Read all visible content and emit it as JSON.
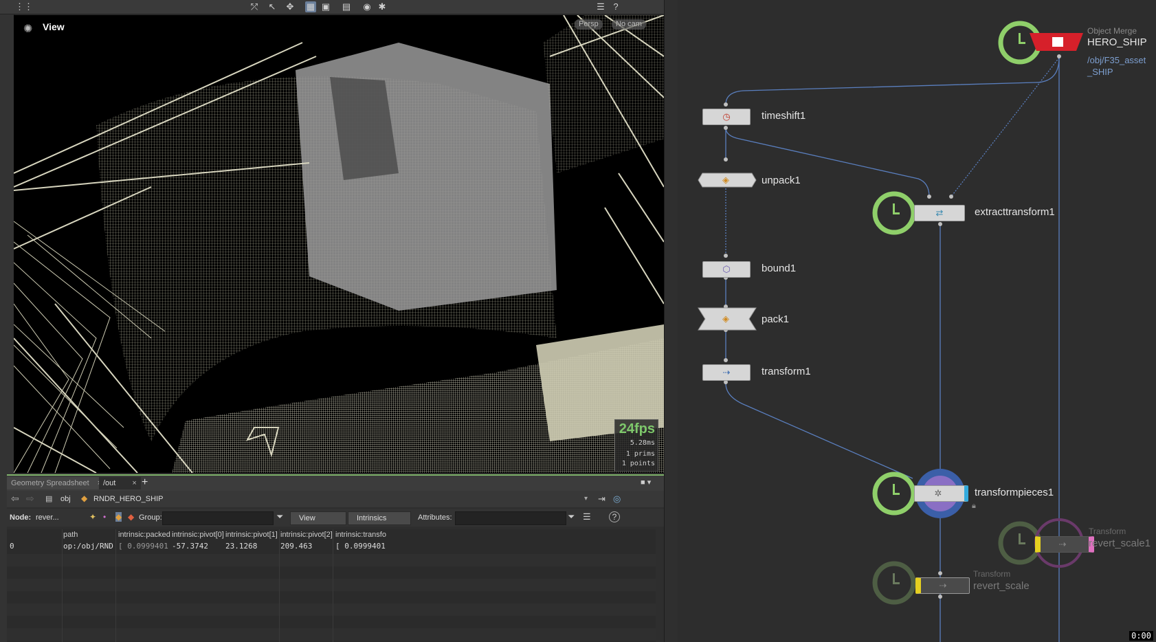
{
  "viewport": {
    "title": "View",
    "camera_mode": "Persp",
    "camera_name": "No cam",
    "fps": "24fps",
    "render_time": "5.28ms",
    "prims": "1  prims",
    "points": "1 points"
  },
  "spreadsheet": {
    "tabs": [
      {
        "label": "Geometry Spreadsheet"
      },
      {
        "label": "/out"
      }
    ],
    "path": {
      "root": "obj",
      "node": "RNDR_HERO_SHIP"
    },
    "filter": {
      "node_label": "Node:",
      "node_value": "rever...",
      "group_label": "Group:",
      "view_value": "View",
      "intrinsics_value": "Intrinsics",
      "attributes_label": "Attributes:"
    },
    "columns": [
      "path",
      "intrinsic:packed",
      "intrinsic:pivot[0]",
      "intrinsic:pivot[1]",
      "intrinsic:pivot[2]",
      "intrinsic:transfo"
    ],
    "rows": [
      {
        "index": "0",
        "cells": [
          "op:/obj/RND",
          "[ 0.0999401",
          "-57.3742",
          "23.1268",
          "209.463",
          "[ 0.0999401"
        ]
      }
    ]
  },
  "network": {
    "object_merge": {
      "type": "Object Merge",
      "name": "HERO_SHIP",
      "path_line1": "/obj/F35_asset",
      "path_line2": "_SHIP"
    },
    "nodes": {
      "timeshift": "timeshift1",
      "unpack": "unpack1",
      "extract": "extracttransform1",
      "bound": "bound1",
      "pack": "pack1",
      "transform": "transform1",
      "pieces": "transformpieces1"
    },
    "revert_scale1": {
      "type": "Transform",
      "name": "revert_scale1"
    },
    "revert_scale": {
      "type": "Transform",
      "name": "revert_scale"
    },
    "clock": "0:00"
  },
  "colors": {
    "accent_green": "#8fcf6a",
    "merge_red": "#d6202a",
    "wire_blue": "#5a7fbf",
    "wireframe": "#d8d6bf"
  }
}
